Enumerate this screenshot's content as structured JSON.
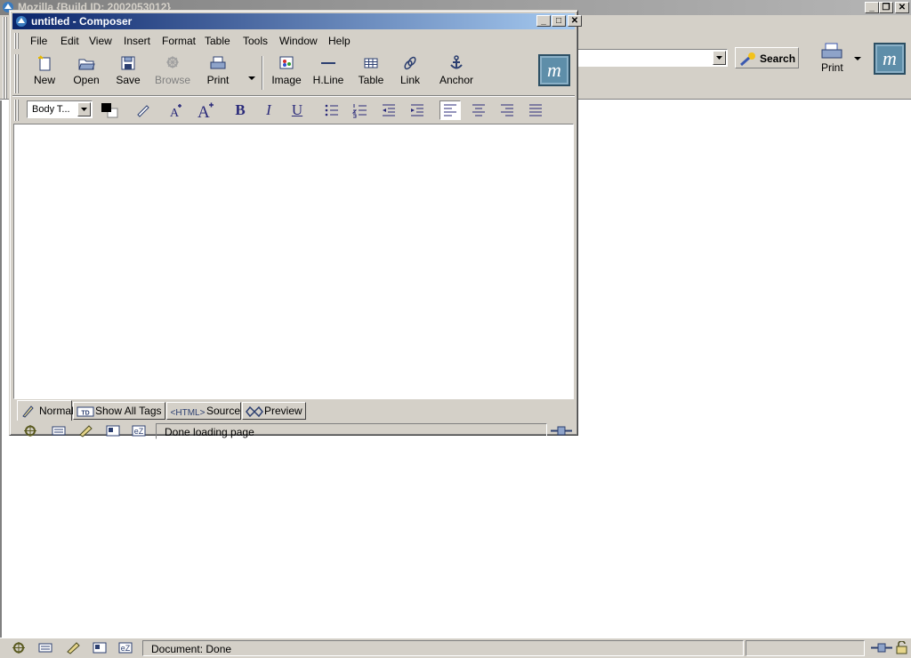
{
  "browser": {
    "title": "Mozilla {Build ID: 2002053012}",
    "search_label": "Search",
    "print_label": "Print",
    "status_text": "Document: Done"
  },
  "composer": {
    "title": "untitled - Composer",
    "menu": [
      "File",
      "Edit",
      "View",
      "Insert",
      "Format",
      "Table",
      "Tools",
      "Window",
      "Help"
    ],
    "toolbar": {
      "new": "New",
      "open": "Open",
      "save": "Save",
      "browse": "Browse",
      "print": "Print",
      "image": "Image",
      "hline": "H.Line",
      "table": "Table",
      "link": "Link",
      "anchor": "Anchor"
    },
    "paragraph_format": "Body T...",
    "format_buttons": {
      "bold": "B",
      "italic": "I",
      "underline": "U"
    },
    "tabs": {
      "normal": "Normal",
      "show_all_tags": "Show All Tags",
      "source": "Source",
      "preview": "Preview"
    },
    "status_text": "Done loading page"
  },
  "colors": {
    "active_title": "#0a246a",
    "inactive_title": "#808080",
    "chrome": "#d4d0c8",
    "logo": "#5e8ea9"
  }
}
